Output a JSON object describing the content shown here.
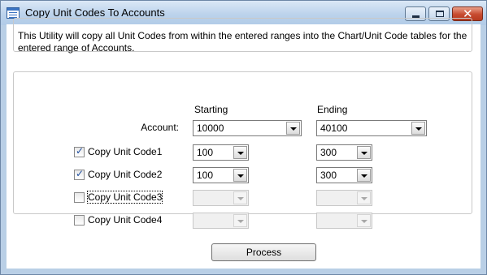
{
  "window": {
    "title": "Copy Unit Codes To Accounts"
  },
  "info": {
    "text": "This Utility will copy all Unit Codes from within the entered ranges into the Chart/Unit Code tables for the entered range of Accounts."
  },
  "headers": {
    "starting": "Starting",
    "ending": "Ending"
  },
  "account": {
    "label": "Account:",
    "starting": "10000",
    "ending": "40100"
  },
  "unit_codes": [
    {
      "label": "Copy Unit Code1",
      "checked": true,
      "starting": "100",
      "ending": "300"
    },
    {
      "label": "Copy Unit Code2",
      "checked": true,
      "starting": "100",
      "ending": "300"
    },
    {
      "label": "Copy Unit Code3",
      "checked": false,
      "starting": "",
      "ending": ""
    },
    {
      "label": "Copy Unit Code4",
      "checked": false,
      "starting": "",
      "ending": ""
    }
  ],
  "process_button": "Process"
}
